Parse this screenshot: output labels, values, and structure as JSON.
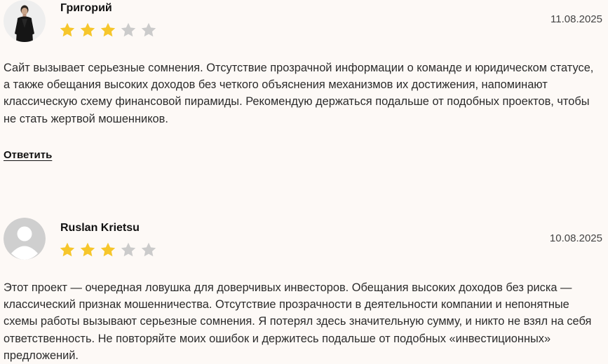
{
  "reviews": [
    {
      "author": "Григорий",
      "date": "11.08.2025",
      "rating": 3,
      "max_rating": 5,
      "avatar": "user-photo",
      "text": "Сайт вызывает серьезные сомнения. Отсутствие прозрачной информации о команде и юридическом статусе, а также обещания высоких доходов без четкого объяснения механизмов их достижения, напоминают классическую схему финансовой пирамиды. Рекомендую держаться подальше от подобных проектов, чтобы не стать жертвой мошенников.",
      "reply_label": "Ответить"
    },
    {
      "author": "Ruslan Krietsu",
      "date": "10.08.2025",
      "rating": 3,
      "max_rating": 5,
      "avatar": "default-user-icon",
      "text": "Этот проект — очередная ловушка для доверчивых инвесторов. Обещания высоких доходов без риска — классический признак мошенничества. Отсутствие прозрачности в деятельности компании и непонятные схемы работы вызывают серьезные сомнения. Я потерял здесь значительную сумму, и никто не взял на себя ответственность. Не повторяйте моих ошибок и держитесь подальше от подобных «инвестиционных» предложений."
    }
  ],
  "colors": {
    "background": "#fdf9f6",
    "star_filled": "#f6c62b",
    "star_empty": "#cbcbcb",
    "avatar_placeholder": "#cfcfcf"
  }
}
